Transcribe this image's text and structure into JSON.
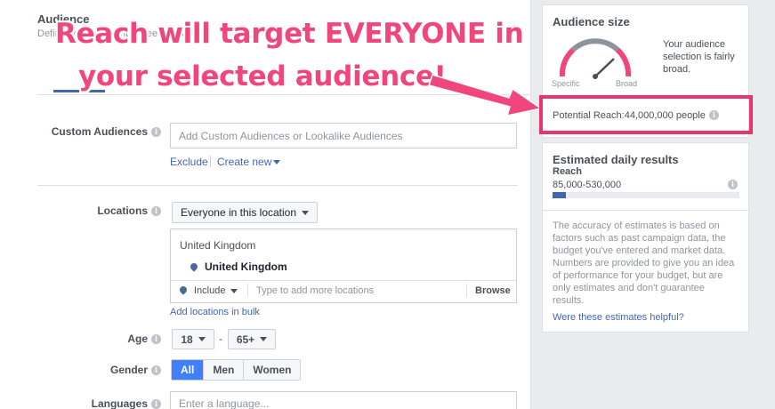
{
  "audience": {
    "title": "Audience",
    "description": "Define who you want to see your ads."
  },
  "custom_audiences": {
    "label": "Custom Audiences",
    "placeholder": "Add Custom Audiences or Lookalike Audiences",
    "exclude": "Exclude",
    "create_new": "Create new"
  },
  "locations": {
    "label": "Locations",
    "dropdown": "Everyone in this location",
    "country_header": "United Kingdom",
    "selected": "United Kingdom",
    "include": "Include",
    "placeholder": "Type to add more locations",
    "browse": "Browse",
    "bulk_link": "Add locations in bulk"
  },
  "age": {
    "label": "Age",
    "min": "18",
    "max": "65+",
    "separator": "-"
  },
  "gender": {
    "label": "Gender",
    "options": [
      "All",
      "Men",
      "Women"
    ],
    "selected": "All"
  },
  "languages": {
    "label": "Languages",
    "placeholder": "Enter a language..."
  },
  "audience_size": {
    "title": "Audience size",
    "description": "Your audience selection is fairly broad.",
    "specific": "Specific",
    "broad": "Broad",
    "potential_reach_label": "Potential Reach:",
    "potential_reach_value": "44,000,000 people"
  },
  "estimated": {
    "title": "Estimated daily results",
    "reach_label": "Reach",
    "reach_value": "85,000-530,000",
    "bar_fill_fraction": 0.07,
    "disclaimer": "The accuracy of estimates is based on factors such as past campaign data, the budget you've entered and market data. Numbers are provided to give you an idea of performance for your budget, but are only estimates and don't guarantee results.",
    "helpful_link": "Were these estimates helpful?"
  },
  "annotation": {
    "line1": "Reach will target EVERYONE in",
    "line2": "your selected audience!"
  },
  "colors": {
    "accent": "#4267b2",
    "highlight": "#e8356e",
    "annotation_text": "#f0467c",
    "active_segment": "#4080ff"
  }
}
